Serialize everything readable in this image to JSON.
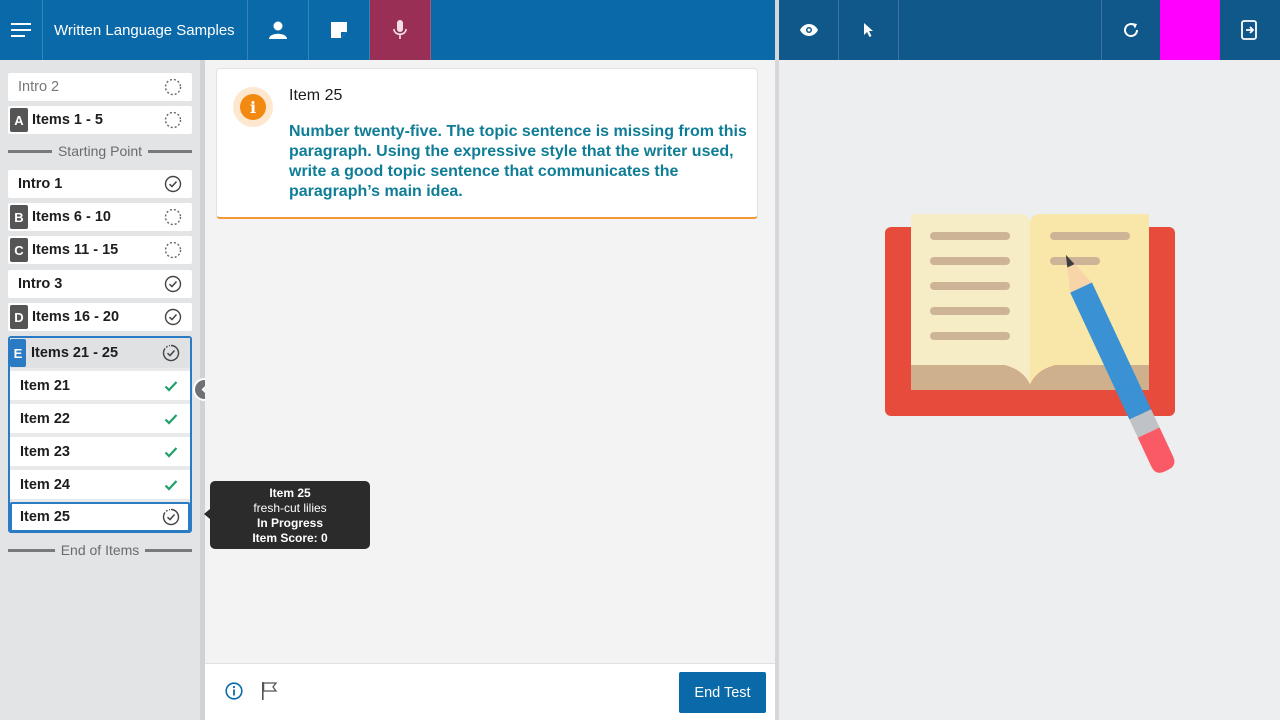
{
  "header": {
    "title": "Written Language Samples"
  },
  "sidebar": {
    "top_items": [
      {
        "label": "Intro 2",
        "badge": ""
      },
      {
        "label": "Items 1 - 5",
        "badge": "A"
      }
    ],
    "starting_point": "Starting Point",
    "items": [
      {
        "label": "Intro 1",
        "badge": ""
      },
      {
        "label": "Items 6 - 10",
        "badge": "B"
      },
      {
        "label": "Items 11 - 15",
        "badge": "C"
      },
      {
        "label": "Intro 3",
        "badge": ""
      },
      {
        "label": "Items 16 - 20",
        "badge": "D"
      }
    ],
    "group": {
      "badge": "E",
      "label": "Items 21 - 25",
      "sub_items": [
        {
          "label": "Item 21"
        },
        {
          "label": "Item 22"
        },
        {
          "label": "Item 23"
        },
        {
          "label": "Item 24"
        },
        {
          "label": "Item 25"
        }
      ]
    },
    "end_of_items": "End of Items"
  },
  "card": {
    "title": "Item 25",
    "text": "Number twenty-five. The topic sentence is missing from this paragraph. Using the expressive style that the writer used, write a good topic sentence that communicates the paragraph’s main idea."
  },
  "tooltip": {
    "title": "Item 25",
    "subtitle": "fresh-cut lilies",
    "status": "In Progress",
    "score": "Item Score: 0"
  },
  "footer": {
    "end_test": "End Test"
  },
  "colors": {
    "primary": "#0a69a8",
    "accent_text": "#107d96",
    "check_green": "#22a06b",
    "mic_active": "#9a2f55",
    "magenta": "#ff00ff",
    "info_orange": "#f28a12"
  }
}
